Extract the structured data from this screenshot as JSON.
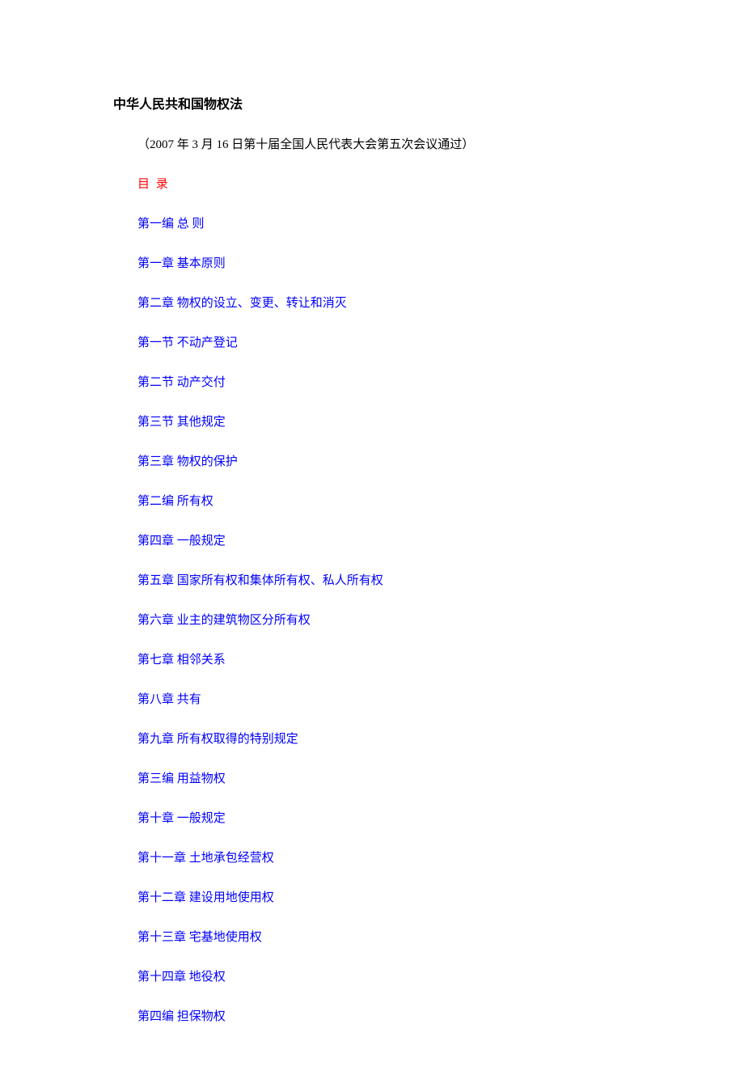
{
  "title": "中华人民共和国物权法",
  "subtitle": "（2007 年 3 月 16 日第十届全国人民代表大会第五次会议通过）",
  "toc_heading": "目 录",
  "toc_items": [
    "第一编  总  则",
    "第一章  基本原则",
    "第二章  物权的设立、变更、转让和消灭",
    "第一节  不动产登记",
    "第二节  动产交付",
    "第三节  其他规定",
    "第三章  物权的保护",
    "第二编  所有权",
    "第四章  一般规定",
    "第五章  国家所有权和集体所有权、私人所有权",
    "第六章  业主的建筑物区分所有权",
    "第七章  相邻关系",
    "第八章  共有",
    "第九章  所有权取得的特别规定",
    "第三编  用益物权",
    "第十章  一般规定",
    "第十一章  土地承包经营权",
    "第十二章  建设用地使用权",
    "第十三章  宅基地使用权",
    "第十四章  地役权",
    "第四编  担保物权"
  ]
}
